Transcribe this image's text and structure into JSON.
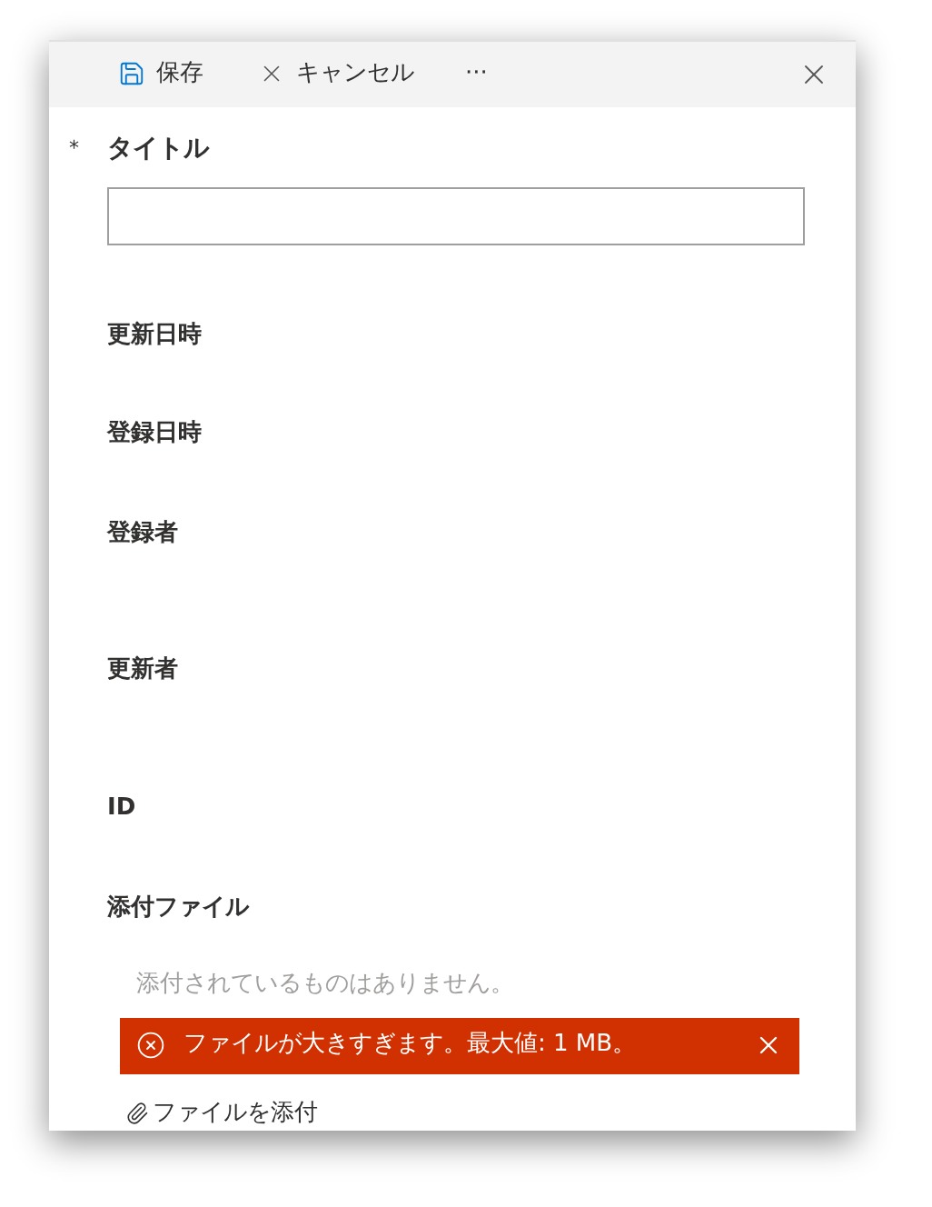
{
  "toolbar": {
    "save": "保存",
    "cancel": "キャンセル",
    "more": "···"
  },
  "fields": [
    {
      "kind": "input",
      "label": "タイトル",
      "required_mark": "*"
    },
    {
      "kind": "date",
      "label": "更新日時"
    },
    {
      "kind": "date",
      "label": "登録日時"
    },
    {
      "kind": "person",
      "label": "登録者"
    },
    {
      "kind": "person",
      "label": "更新者"
    },
    {
      "kind": "date",
      "label": "ID"
    }
  ],
  "attachments": {
    "label": "添付ファイル",
    "empty_text": "添付されているものはありません。",
    "error": "ファイルが大きすぎます。最大値: 1 MB。",
    "add": "ファイルを添付"
  }
}
